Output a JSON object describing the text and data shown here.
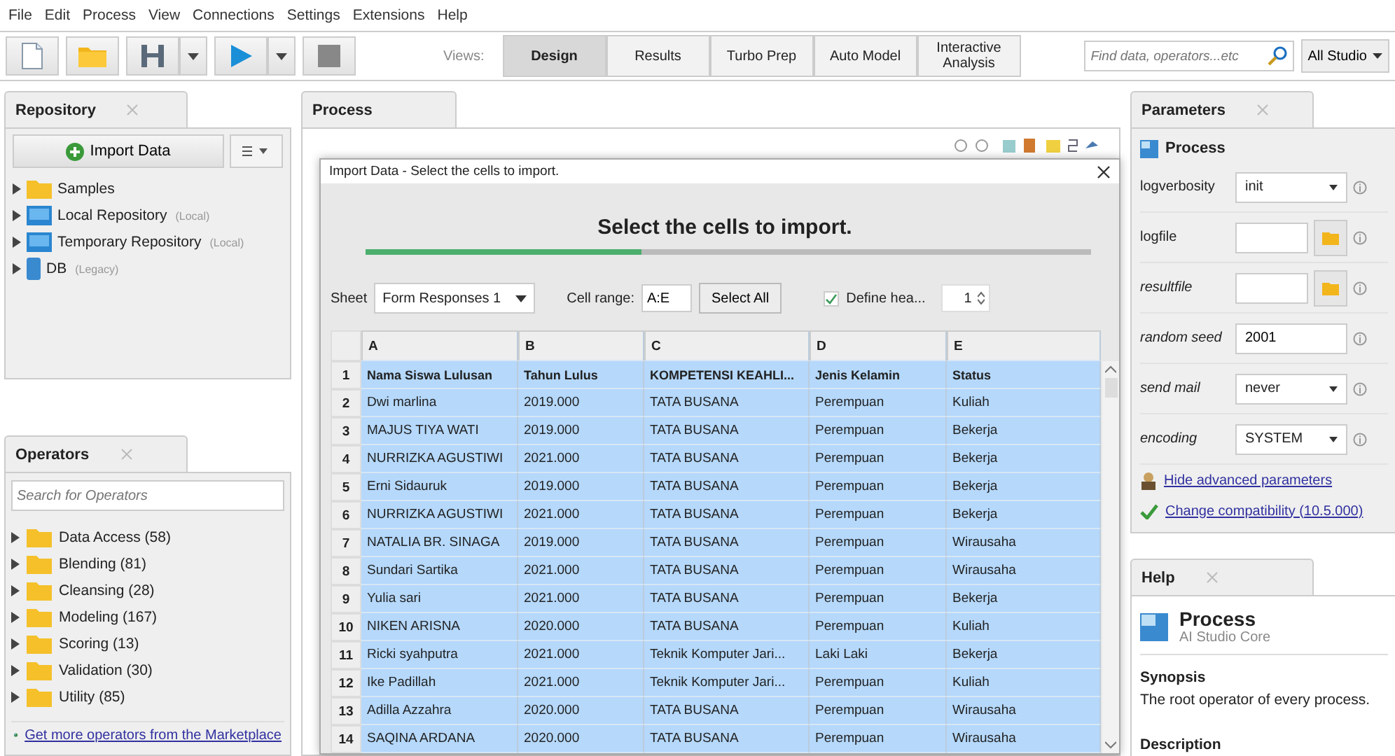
{
  "menu": [
    "File",
    "Edit",
    "Process",
    "View",
    "Connections",
    "Settings",
    "Extensions",
    "Help"
  ],
  "toolbar": {
    "views_label": "Views:",
    "views": [
      {
        "label": "Design",
        "selected": true
      },
      {
        "label": "Results",
        "selected": false
      },
      {
        "label": "Turbo Prep",
        "selected": false
      },
      {
        "label": "Auto Model",
        "selected": false
      },
      {
        "label": "Interactive Analysis",
        "selected": false
      }
    ],
    "search": {
      "placeholder": "Find data, operators...etc"
    },
    "scope": "All Studio"
  },
  "repository": {
    "title": "Repository",
    "import_button": "Import Data",
    "items": [
      {
        "label": "Samples",
        "kind": "folder"
      },
      {
        "label": "Local Repository",
        "note": "(Local)",
        "kind": "repository"
      },
      {
        "label": "Temporary Repository",
        "note": "(Local)",
        "kind": "repository"
      },
      {
        "label": "DB",
        "note": "(Legacy)",
        "kind": "database"
      }
    ]
  },
  "operators": {
    "title": "Operators",
    "search": {
      "placeholder": "Search for Operators"
    },
    "items": [
      "Data Access (58)",
      "Blending (81)",
      "Cleansing (28)",
      "Modeling (167)",
      "Scoring (13)",
      "Validation (30)",
      "Utility (85)"
    ],
    "link": "Get more operators from the Marketplace"
  },
  "process": {
    "title": "Process"
  },
  "dialog": {
    "title": "Import Data - Select the cells to import.",
    "heading": "Select the cells to import.",
    "progress": {
      "level": 0.38
    },
    "sheet_label": "Sheet",
    "sheet": "Form Responses 1",
    "range_label": "Cell range:",
    "range": "A:E",
    "select_all": "Select All",
    "define_header": {
      "label": "Define hea...",
      "checked": true
    },
    "header_row": "1",
    "table": {
      "columns": [
        "A",
        "B",
        "C",
        "D",
        "E"
      ],
      "rows": [
        {
          "number": "1",
          "kind": "header",
          "selected": true,
          "cells": [
            "Nama Siswa Lulusan",
            "Tahun Lulus",
            "KOMPETENSI KEAHLI...",
            "Jenis Kelamin",
            "Status"
          ]
        },
        {
          "number": "2",
          "kind": "data",
          "selected": true,
          "cells": [
            "Dwi marlina",
            "2019.000",
            "TATA BUSANA",
            "Perempuan",
            "Kuliah"
          ]
        },
        {
          "number": "3",
          "kind": "data",
          "selected": true,
          "cells": [
            "MAJUS TIYA WATI",
            "2019.000",
            "TATA BUSANA",
            "Perempuan",
            "Bekerja"
          ]
        },
        {
          "number": "4",
          "kind": "data",
          "selected": true,
          "cells": [
            "NURRIZKA AGUSTIWI",
            "2021.000",
            "TATA BUSANA",
            "Perempuan",
            "Bekerja"
          ]
        },
        {
          "number": "5",
          "kind": "data",
          "selected": true,
          "cells": [
            "Erni Sidauruk",
            "2019.000",
            "TATA BUSANA",
            "Perempuan",
            "Bekerja"
          ]
        },
        {
          "number": "6",
          "kind": "data",
          "selected": true,
          "cells": [
            "NURRIZKA AGUSTIWI",
            "2021.000",
            "TATA BUSANA",
            "Perempuan",
            "Bekerja"
          ]
        },
        {
          "number": "7",
          "kind": "data",
          "selected": true,
          "cells": [
            "NATALIA BR. SINAGA",
            "2019.000",
            "TATA BUSANA",
            "Perempuan",
            "Wirausaha"
          ]
        },
        {
          "number": "8",
          "kind": "data",
          "selected": true,
          "cells": [
            "Sundari Sartika",
            "2021.000",
            "TATA BUSANA",
            "Perempuan",
            "Wirausaha"
          ]
        },
        {
          "number": "9",
          "kind": "data",
          "selected": true,
          "cells": [
            "Yulia sari",
            "2021.000",
            "TATA BUSANA",
            "Perempuan",
            "Bekerja"
          ]
        },
        {
          "number": "10",
          "kind": "data",
          "selected": true,
          "cells": [
            "NIKEN ARISNA",
            "2020.000",
            "TATA BUSANA",
            "Perempuan",
            "Kuliah"
          ]
        },
        {
          "number": "11",
          "kind": "data",
          "selected": true,
          "cells": [
            "Ricki syahputra",
            "2021.000",
            "Teknik Komputer Jari...",
            "Laki Laki",
            "Bekerja"
          ]
        },
        {
          "number": "12",
          "kind": "data",
          "selected": true,
          "cells": [
            "Ike Padillah",
            "2021.000",
            "Teknik Komputer Jari...",
            "Perempuan",
            "Kuliah"
          ]
        },
        {
          "number": "13",
          "kind": "data",
          "selected": true,
          "cells": [
            "Adilla Azzahra",
            "2020.000",
            "TATA BUSANA",
            "Perempuan",
            "Wirausaha"
          ]
        },
        {
          "number": "14",
          "kind": "data",
          "selected": true,
          "cells": [
            "SAQINA ARDANA",
            "2020.000",
            "TATA BUSANA",
            "Perempuan",
            "Wirausaha"
          ]
        }
      ]
    }
  },
  "parameters": {
    "title": "Parameters",
    "operator": "Process",
    "rows": [
      {
        "name": "logverbosity",
        "expert": false,
        "kind": "select",
        "value": "init"
      },
      {
        "name": "logfile",
        "expert": false,
        "kind": "file"
      },
      {
        "name": "resultfile",
        "expert": true,
        "kind": "file"
      },
      {
        "name": "random seed",
        "expert": true,
        "kind": "text",
        "value": "2001"
      },
      {
        "name": "send mail",
        "expert": true,
        "kind": "select",
        "value": "never"
      },
      {
        "name": "encoding",
        "expert": true,
        "kind": "select",
        "value": "SYSTEM"
      }
    ],
    "links": [
      "Hide advanced parameters",
      "Change compatibility (10.5.000)"
    ]
  },
  "help": {
    "title": "Help",
    "operator": "Process",
    "source": "AI Studio Core",
    "synopsis_heading": "Synopsis",
    "synopsis": "The root operator of every process.",
    "description_heading": "Description"
  }
}
